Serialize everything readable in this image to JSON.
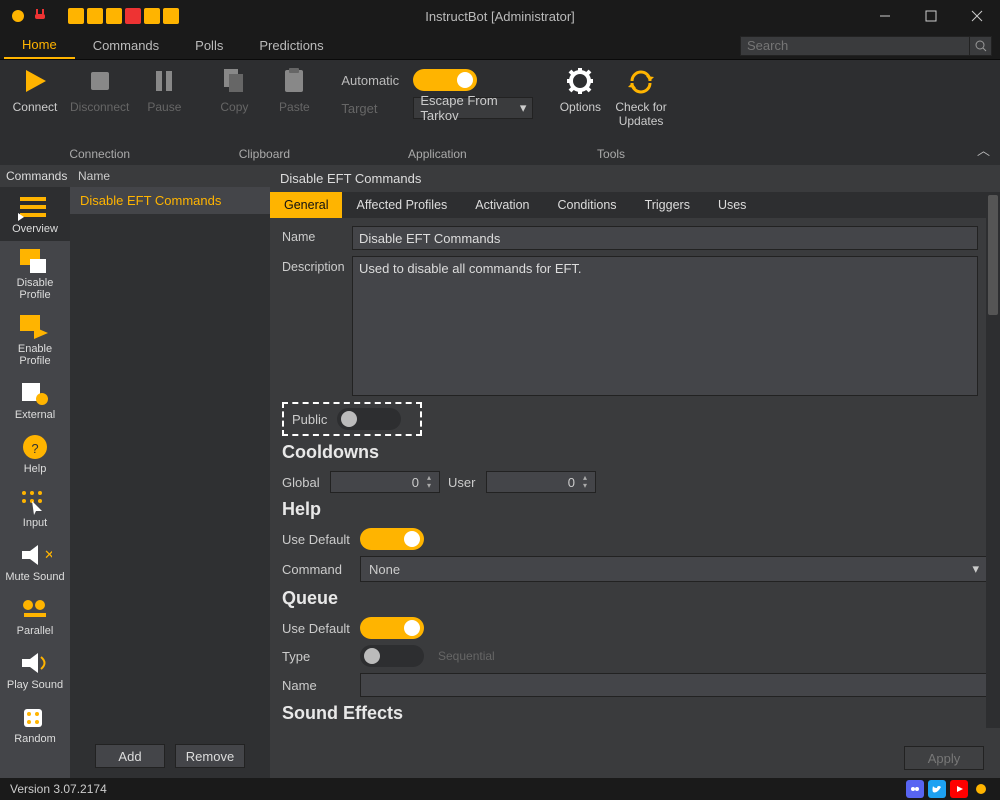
{
  "window": {
    "title": "InstructBot [Administrator]"
  },
  "menubar": {
    "items": [
      "Home",
      "Commands",
      "Polls",
      "Predictions"
    ],
    "active": 0,
    "search_placeholder": "Search"
  },
  "ribbon": {
    "connection": {
      "label": "Connection",
      "connect": "Connect",
      "disconnect": "Disconnect",
      "pause": "Pause"
    },
    "clipboard": {
      "label": "Clipboard",
      "copy": "Copy",
      "paste": "Paste"
    },
    "application": {
      "label": "Application",
      "automatic": "Automatic",
      "automatic_on": true,
      "target": "Target",
      "target_value": "Escape From Tarkov"
    },
    "tools": {
      "label": "Tools",
      "options": "Options",
      "check": "Check for\nUpdates"
    }
  },
  "rail": {
    "header": "Commands",
    "items": [
      {
        "label": "Overview"
      },
      {
        "label": "Disable Profile"
      },
      {
        "label": "Enable Profile"
      },
      {
        "label": "External"
      },
      {
        "label": "Help"
      },
      {
        "label": "Input"
      },
      {
        "label": "Mute Sound"
      },
      {
        "label": "Parallel"
      },
      {
        "label": "Play Sound"
      },
      {
        "label": "Random"
      }
    ],
    "active": 0
  },
  "mid": {
    "header": "Name",
    "rows": [
      {
        "label": "Disable EFT Commands"
      }
    ],
    "add": "Add",
    "remove": "Remove"
  },
  "main": {
    "title": "Disable EFT Commands",
    "tabs": [
      "General",
      "Affected Profiles",
      "Activation",
      "Conditions",
      "Triggers",
      "Uses"
    ],
    "active_tab": 0,
    "fields": {
      "name_label": "Name",
      "name_value": "Disable EFT Commands",
      "desc_label": "Description",
      "desc_value": "Used to disable all commands for EFT.",
      "public_label": "Public",
      "public_on": false,
      "cooldowns_header": "Cooldowns",
      "global_label": "Global",
      "global_value": "0",
      "user_label": "User",
      "user_value": "0",
      "help_header": "Help",
      "use_default_label": "Use Default",
      "help_use_default_on": true,
      "command_label": "Command",
      "command_value": "None",
      "queue_header": "Queue",
      "queue_use_default_on": true,
      "type_label": "Type",
      "type_value": "Sequential",
      "type_on": false,
      "qname_label": "Name",
      "qname_value": "",
      "sound_header": "Sound Effects"
    },
    "apply": "Apply"
  },
  "status": {
    "version": "Version 3.07.2174"
  }
}
